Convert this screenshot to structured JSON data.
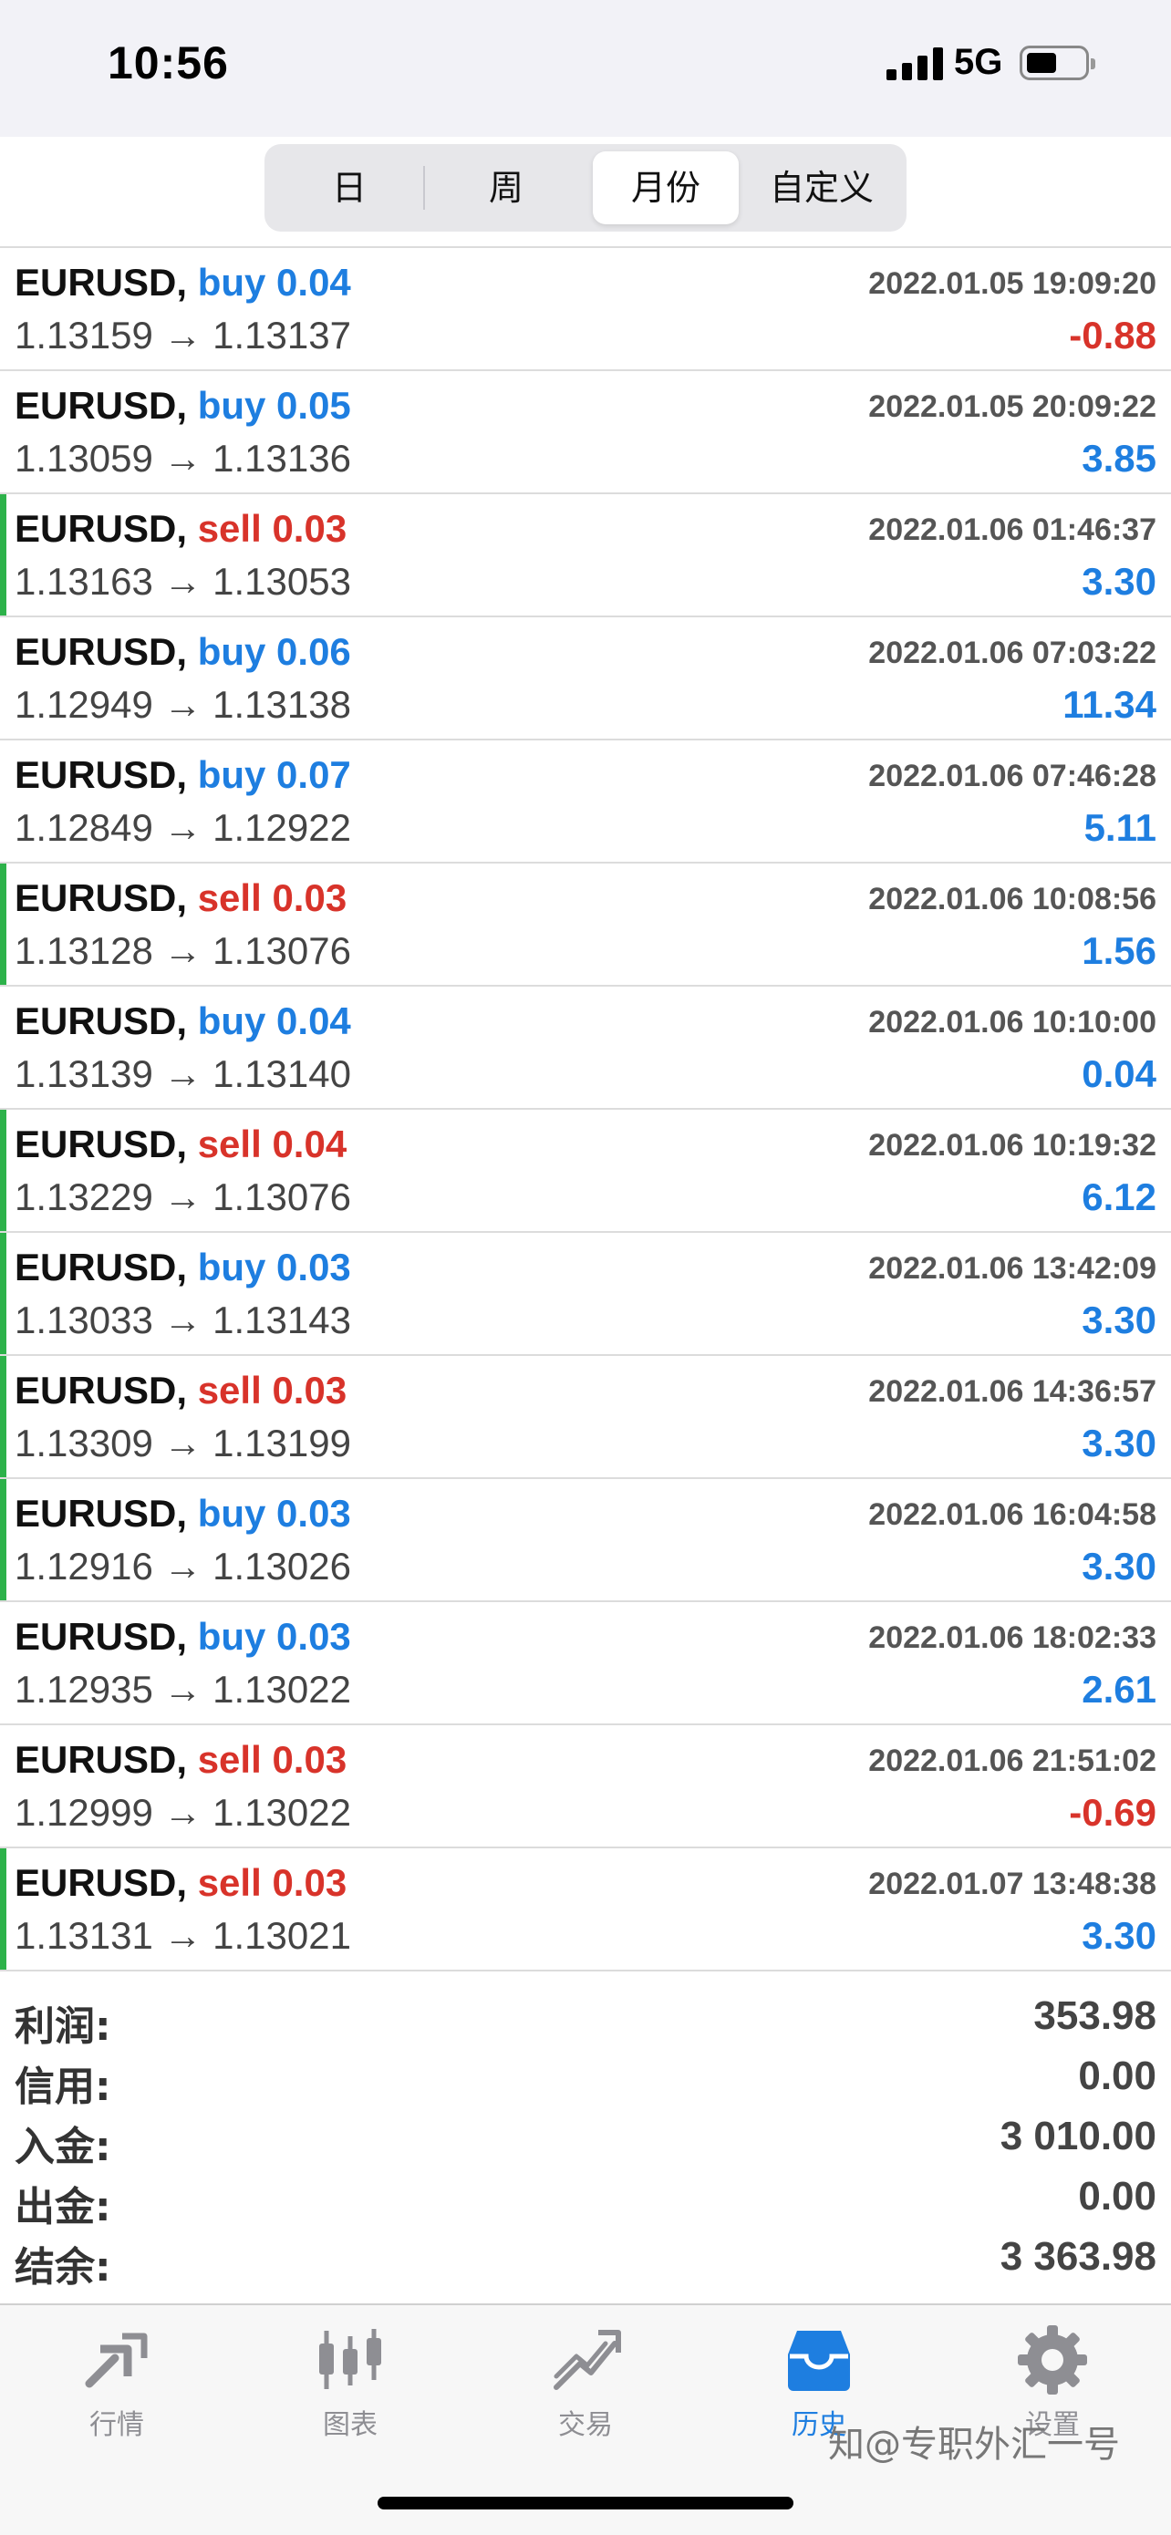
{
  "status_bar": {
    "time": "10:56",
    "network": "5G",
    "battery_percent": 50
  },
  "period_tabs": {
    "selected": "月份",
    "items": [
      "日",
      "周",
      "月份",
      "自定义"
    ]
  },
  "trades": [
    {
      "symbol": "EURUSD,",
      "side": "buy",
      "volume": "0.04",
      "datetime": "2022.01.05 19:09:20",
      "prices": "1.13159 → 1.13137",
      "profit": "-0.88",
      "marked": false
    },
    {
      "symbol": "EURUSD,",
      "side": "buy",
      "volume": "0.05",
      "datetime": "2022.01.05 20:09:22",
      "prices": "1.13059 → 1.13136",
      "profit": "3.85",
      "marked": false
    },
    {
      "symbol": "EURUSD,",
      "side": "sell",
      "volume": "0.03",
      "datetime": "2022.01.06 01:46:37",
      "prices": "1.13163 → 1.13053",
      "profit": "3.30",
      "marked": true
    },
    {
      "symbol": "EURUSD,",
      "side": "buy",
      "volume": "0.06",
      "datetime": "2022.01.06 07:03:22",
      "prices": "1.12949 → 1.13138",
      "profit": "11.34",
      "marked": false
    },
    {
      "symbol": "EURUSD,",
      "side": "buy",
      "volume": "0.07",
      "datetime": "2022.01.06 07:46:28",
      "prices": "1.12849 → 1.12922",
      "profit": "5.11",
      "marked": false
    },
    {
      "symbol": "EURUSD,",
      "side": "sell",
      "volume": "0.03",
      "datetime": "2022.01.06 10:08:56",
      "prices": "1.13128 → 1.13076",
      "profit": "1.56",
      "marked": true
    },
    {
      "symbol": "EURUSD,",
      "side": "buy",
      "volume": "0.04",
      "datetime": "2022.01.06 10:10:00",
      "prices": "1.13139 → 1.13140",
      "profit": "0.04",
      "marked": false
    },
    {
      "symbol": "EURUSD,",
      "side": "sell",
      "volume": "0.04",
      "datetime": "2022.01.06 10:19:32",
      "prices": "1.13229 → 1.13076",
      "profit": "6.12",
      "marked": true
    },
    {
      "symbol": "EURUSD,",
      "side": "buy",
      "volume": "0.03",
      "datetime": "2022.01.06 13:42:09",
      "prices": "1.13033 → 1.13143",
      "profit": "3.30",
      "marked": true
    },
    {
      "symbol": "EURUSD,",
      "side": "sell",
      "volume": "0.03",
      "datetime": "2022.01.06 14:36:57",
      "prices": "1.13309 → 1.13199",
      "profit": "3.30",
      "marked": true
    },
    {
      "symbol": "EURUSD,",
      "side": "buy",
      "volume": "0.03",
      "datetime": "2022.01.06 16:04:58",
      "prices": "1.12916 → 1.13026",
      "profit": "3.30",
      "marked": true
    },
    {
      "symbol": "EURUSD,",
      "side": "buy",
      "volume": "0.03",
      "datetime": "2022.01.06 18:02:33",
      "prices": "1.12935 → 1.13022",
      "profit": "2.61",
      "marked": false
    },
    {
      "symbol": "EURUSD,",
      "side": "sell",
      "volume": "0.03",
      "datetime": "2022.01.06 21:51:02",
      "prices": "1.12999 → 1.13022",
      "profit": "-0.69",
      "marked": false
    },
    {
      "symbol": "EURUSD,",
      "side": "sell",
      "volume": "0.03",
      "datetime": "2022.01.07 13:48:38",
      "prices": "1.13131 → 1.13021",
      "profit": "3.30",
      "marked": true
    }
  ],
  "summary": [
    {
      "label": "利润:",
      "value": "353.98"
    },
    {
      "label": "信用:",
      "value": "0.00"
    },
    {
      "label": "入金:",
      "value": "3 010.00"
    },
    {
      "label": "出金:",
      "value": "0.00"
    },
    {
      "label": "结余:",
      "value": "3 363.98"
    }
  ],
  "tab_bar": {
    "active": "历史",
    "items": [
      {
        "label": "行情",
        "icon": "quotes-arrows-icon"
      },
      {
        "label": "图表",
        "icon": "candlestick-chart-icon"
      },
      {
        "label": "交易",
        "icon": "trade-trend-icon"
      },
      {
        "label": "历史",
        "icon": "history-inbox-icon"
      },
      {
        "label": "设置",
        "icon": "settings-gear-icon"
      }
    ]
  },
  "watermark": "知@专职外汇一号",
  "colors": {
    "buy": "#1e7ee0",
    "sell": "#d8332a",
    "marker": "#2db24a",
    "tab_active": "#1e7ee0",
    "tab_inactive": "#8e8e93"
  }
}
